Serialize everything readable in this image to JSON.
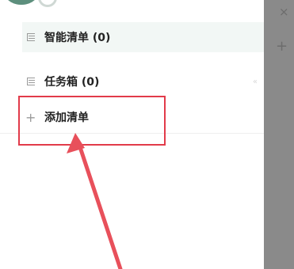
{
  "drawer": {
    "smart_list": {
      "label": "智能清单 (0)",
      "icon": "list-icon"
    },
    "inbox": {
      "label": "任务箱 (0)",
      "icon": "list-icon",
      "chevron": "«"
    },
    "add_list": {
      "label": "添加清单",
      "icon": "plus-icon",
      "icon_glyph": "+"
    }
  },
  "overlay": {
    "close_glyph": "×",
    "add_glyph": "+"
  },
  "annotation": {
    "highlight_color": "#e23b4a"
  }
}
